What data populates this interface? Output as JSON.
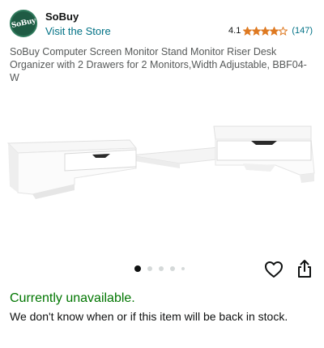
{
  "seller": {
    "logo_text": "SoBuy",
    "name": "SoBuy",
    "store_link": "Visit the Store",
    "brand_color": "#1f5b44"
  },
  "rating": {
    "value": "4.1",
    "stars": 4.1,
    "count": "(147)",
    "star_color": "#de7921"
  },
  "product": {
    "title": "SoBuy Computer Screen Monitor Stand Monitor Riser Desk Organizer with 2 Drawers for 2 Monitors,Width Adjustable, BBF04-W"
  },
  "gallery": {
    "image_count": 5,
    "active_index": 0
  },
  "actions": {
    "wishlist_icon": "heart-icon",
    "share_icon": "share-icon"
  },
  "availability": {
    "status": "Currently unavailable.",
    "status_color": "#007600",
    "note": "We don't know when or if this item will be back in stock."
  }
}
